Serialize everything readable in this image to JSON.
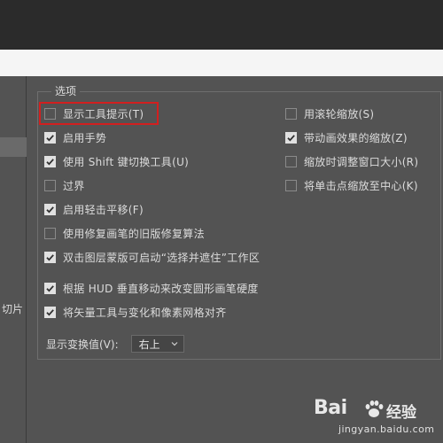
{
  "group": {
    "title": "选项"
  },
  "left_panel": {
    "label": "切片"
  },
  "options_left": [
    {
      "label": "显示工具提示(T)",
      "checked": false
    },
    {
      "label": "启用手势",
      "checked": true
    },
    {
      "label": "使用 Shift 键切换工具(U)",
      "checked": true
    },
    {
      "label": "过界",
      "checked": false
    },
    {
      "label": "启用轻击平移(F)",
      "checked": true
    },
    {
      "label": "使用修复画笔的旧版修复算法",
      "checked": false
    },
    {
      "label": "双击图层蒙版可启动“选择并遮住”工作区",
      "checked": true
    },
    {
      "label": "根据 HUD 垂直移动来改变圆形画笔硬度",
      "checked": true
    },
    {
      "label": "将矢量工具与变化和像素网格对齐",
      "checked": true
    }
  ],
  "options_right": [
    {
      "label": "用滚轮缩放(S)",
      "checked": false
    },
    {
      "label": "带动画效果的缩放(Z)",
      "checked": true
    },
    {
      "label": "缩放时调整窗口大小(R)",
      "checked": false
    },
    {
      "label": "将单击点缩放至中心(K)",
      "checked": false
    }
  ],
  "transform_value": {
    "label": "显示变换值(V):",
    "selected": "右上"
  },
  "highlight": {
    "color": "#d21f1f"
  },
  "watermark": {
    "brand": "Bai",
    "name": "经验",
    "url": "jingyan.baidu.com"
  }
}
